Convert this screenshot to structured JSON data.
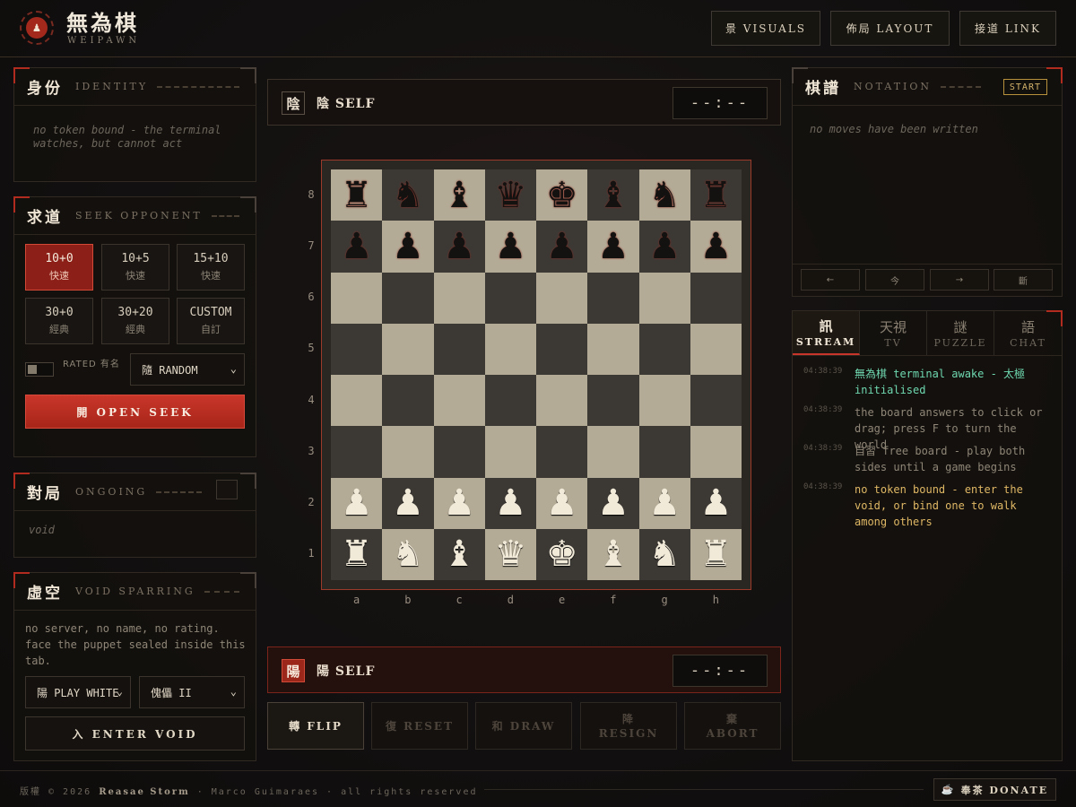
{
  "header": {
    "title": "無為棋",
    "subtitle": "WEIPAWN",
    "buttons": [
      "景 VISUALS",
      "佈局 LAYOUT",
      "接道 LINK"
    ]
  },
  "identity": {
    "cn": "身份",
    "en": "IDENTITY",
    "message": "no token bound - the terminal watches, but cannot act"
  },
  "seek": {
    "cn": "求道",
    "en": "SEEK OPPONENT",
    "time_controls": [
      {
        "time": "10+0",
        "type": "快速",
        "active": true
      },
      {
        "time": "10+5",
        "type": "快速",
        "active": false
      },
      {
        "time": "15+10",
        "type": "快速",
        "active": false
      },
      {
        "time": "30+0",
        "type": "經典",
        "active": false
      },
      {
        "time": "30+20",
        "type": "經典",
        "active": false
      },
      {
        "time": "CUSTOM",
        "type": "自訂",
        "active": false
      }
    ],
    "rated_label": "RATED 有名",
    "color_select": "隨 RANDOM",
    "open_seek_label": "開 OPEN SEEK"
  },
  "ongoing": {
    "cn": "對局",
    "en": "ONGOING",
    "empty": "void"
  },
  "void_sparring": {
    "cn": "虛空",
    "en": "VOID SPARRING",
    "description": "no server, no name, no rating. face the puppet sealed inside this tab.",
    "side_select": "陽 PLAY WHITE",
    "engine_select": "傀儡 II",
    "enter_label": "入 ENTER VOID"
  },
  "top_player": {
    "icon": "陰",
    "name": "陰 SELF",
    "clock": "--:--"
  },
  "bottom_player": {
    "icon": "陽",
    "name": "陽 SELF",
    "clock": "--:--"
  },
  "board": {
    "ranks": [
      "8",
      "7",
      "6",
      "5",
      "4",
      "3",
      "2",
      "1"
    ],
    "files": [
      "a",
      "b",
      "c",
      "d",
      "e",
      "f",
      "g",
      "h"
    ],
    "position": [
      [
        "br",
        "bn",
        "bb",
        "bq",
        "bk",
        "bb",
        "bn",
        "br"
      ],
      [
        "bp",
        "bp",
        "bp",
        "bp",
        "bp",
        "bp",
        "bp",
        "bp"
      ],
      [
        "",
        "",
        "",
        "",
        "",
        "",
        "",
        ""
      ],
      [
        "",
        "",
        "",
        "",
        "",
        "",
        "",
        ""
      ],
      [
        "",
        "",
        "",
        "",
        "",
        "",
        "",
        ""
      ],
      [
        "",
        "",
        "",
        "",
        "",
        "",
        "",
        ""
      ],
      [
        "wp",
        "wp",
        "wp",
        "wp",
        "wp",
        "wp",
        "wp",
        "wp"
      ],
      [
        "wr",
        "wn",
        "wb",
        "wq",
        "wk",
        "wb",
        "wn",
        "wr"
      ]
    ]
  },
  "actions": [
    {
      "label": "轉 FLIP",
      "enabled": true
    },
    {
      "label": "復 RESET",
      "enabled": false
    },
    {
      "label": "和 DRAW",
      "enabled": false
    },
    {
      "label": "降\nRESIGN",
      "enabled": false
    },
    {
      "label": "棄\nABORT",
      "enabled": false
    }
  ],
  "notation": {
    "cn": "棋譜",
    "en": "NOTATION",
    "badge": "START",
    "empty": "no moves have been written",
    "nav": [
      "←",
      "今",
      "→",
      "斷"
    ]
  },
  "tabs": [
    {
      "cn": "訊",
      "en": "STREAM",
      "active": true
    },
    {
      "cn": "天視",
      "en": "TV",
      "active": false
    },
    {
      "cn": "謎",
      "en": "PUZZLE",
      "active": false
    },
    {
      "cn": "語",
      "en": "CHAT",
      "active": false
    }
  ],
  "stream": [
    {
      "time": "04:38:39",
      "text": "無為棋 terminal awake - 太極 initialised",
      "color": "#6fd8b0"
    },
    {
      "time": "04:38:39",
      "text": "the board answers to click or drag; press F to turn the world",
      "color": "#8f8677"
    },
    {
      "time": "04:38:39",
      "text": "自習 free board - play both sides until a game begins",
      "color": "#8f8677"
    },
    {
      "time": "04:38:39",
      "text": "no token bound - enter the void, or bind one to walk among others",
      "color": "#e0b865"
    }
  ],
  "footer": {
    "prefix": "版權 © 2026",
    "author": "Reasae Storm",
    "rest": "· Marco Guimaraes · all rights reserved",
    "donate": "奉茶 DONATE"
  },
  "colors": {
    "accent_red": "#c8352a",
    "light_square": "#b4ab96",
    "dark_square": "#3c3935",
    "gold": "#d4b36a"
  }
}
